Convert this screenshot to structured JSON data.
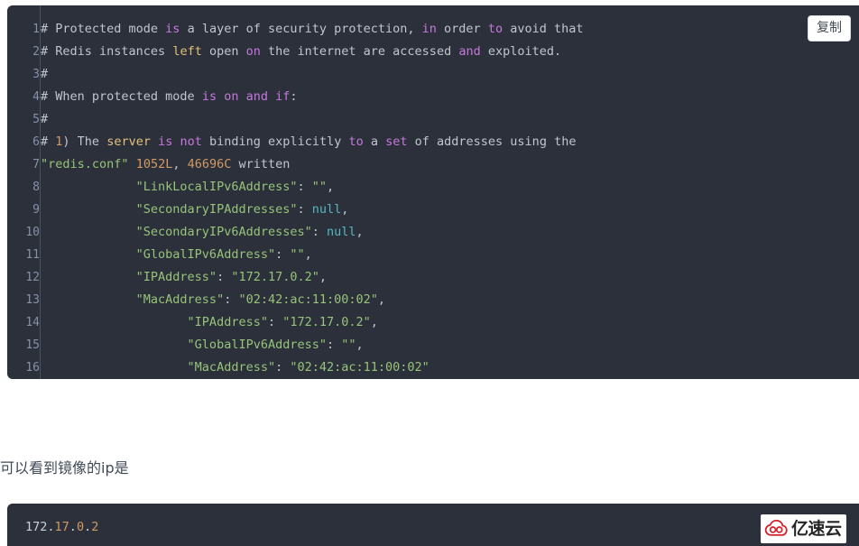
{
  "code_block_1": {
    "copy_button_label": "复制",
    "language": "bash",
    "lines": [
      {
        "n": "1",
        "tokens": [
          {
            "t": "# Protected mode ",
            "c": "cmt"
          },
          {
            "t": "is",
            "c": "kw"
          },
          {
            "t": " a layer of security protection, ",
            "c": "cmt"
          },
          {
            "t": "in",
            "c": "kw"
          },
          {
            "t": " order ",
            "c": "cmt"
          },
          {
            "t": "to",
            "c": "kw"
          },
          {
            "t": " avoid that",
            "c": "cmt"
          }
        ]
      },
      {
        "n": "2",
        "tokens": [
          {
            "t": "# Redis instances ",
            "c": "cmt"
          },
          {
            "t": "left",
            "c": "fn"
          },
          {
            "t": " open ",
            "c": "cmt"
          },
          {
            "t": "on",
            "c": "kw"
          },
          {
            "t": " the internet are accessed ",
            "c": "cmt"
          },
          {
            "t": "and",
            "c": "kw"
          },
          {
            "t": " exploited.",
            "c": "cmt"
          }
        ]
      },
      {
        "n": "3",
        "tokens": [
          {
            "t": "#",
            "c": "cmt"
          }
        ]
      },
      {
        "n": "4",
        "tokens": [
          {
            "t": "# When protected mode ",
            "c": "cmt"
          },
          {
            "t": "is",
            "c": "kw"
          },
          {
            "t": " ",
            "c": "cmt"
          },
          {
            "t": "on",
            "c": "kw"
          },
          {
            "t": " ",
            "c": "cmt"
          },
          {
            "t": "and",
            "c": "kw"
          },
          {
            "t": " ",
            "c": "cmt"
          },
          {
            "t": "if",
            "c": "kw"
          },
          {
            "t": ":",
            "c": "cmt"
          }
        ]
      },
      {
        "n": "5",
        "tokens": [
          {
            "t": "#",
            "c": "cmt"
          }
        ]
      },
      {
        "n": "6",
        "tokens": [
          {
            "t": "# ",
            "c": "cmt"
          },
          {
            "t": "1",
            "c": "num"
          },
          {
            "t": ") The ",
            "c": "cmt"
          },
          {
            "t": "server",
            "c": "fn"
          },
          {
            "t": " ",
            "c": "cmt"
          },
          {
            "t": "is",
            "c": "kw"
          },
          {
            "t": " ",
            "c": "cmt"
          },
          {
            "t": "not",
            "c": "kw"
          },
          {
            "t": " binding explicitly ",
            "c": "cmt"
          },
          {
            "t": "to",
            "c": "kw"
          },
          {
            "t": " a ",
            "c": "cmt"
          },
          {
            "t": "set",
            "c": "kw"
          },
          {
            "t": " of addresses using the",
            "c": "cmt"
          }
        ]
      },
      {
        "n": "7",
        "tokens": [
          {
            "t": "\"redis.conf\"",
            "c": "str"
          },
          {
            "t": " ",
            "c": "txt"
          },
          {
            "t": "1052L",
            "c": "num"
          },
          {
            "t": ", ",
            "c": "txt"
          },
          {
            "t": "46696C",
            "c": "num"
          },
          {
            "t": " written",
            "c": "txt"
          }
        ]
      },
      {
        "n": "8",
        "tokens": [
          {
            "t": "             \"LinkLocalIPv6Address\"",
            "c": "str"
          },
          {
            "t": ": ",
            "c": "txt"
          },
          {
            "t": "\"\"",
            "c": "str"
          },
          {
            "t": ",",
            "c": "txt"
          }
        ]
      },
      {
        "n": "9",
        "tokens": [
          {
            "t": "             \"SecondaryIPAddresses\"",
            "c": "str"
          },
          {
            "t": ": ",
            "c": "txt"
          },
          {
            "t": "null",
            "c": "null"
          },
          {
            "t": ",",
            "c": "txt"
          }
        ]
      },
      {
        "n": "10",
        "tokens": [
          {
            "t": "             \"SecondaryIPv6Addresses\"",
            "c": "str"
          },
          {
            "t": ": ",
            "c": "txt"
          },
          {
            "t": "null",
            "c": "null"
          },
          {
            "t": ",",
            "c": "txt"
          }
        ]
      },
      {
        "n": "11",
        "tokens": [
          {
            "t": "             \"GlobalIPv6Address\"",
            "c": "str"
          },
          {
            "t": ": ",
            "c": "txt"
          },
          {
            "t": "\"\"",
            "c": "str"
          },
          {
            "t": ",",
            "c": "txt"
          }
        ]
      },
      {
        "n": "12",
        "tokens": [
          {
            "t": "             \"IPAddress\"",
            "c": "str"
          },
          {
            "t": ": ",
            "c": "txt"
          },
          {
            "t": "\"172.17.0.2\"",
            "c": "str"
          },
          {
            "t": ",",
            "c": "txt"
          }
        ]
      },
      {
        "n": "13",
        "tokens": [
          {
            "t": "             \"MacAddress\"",
            "c": "str"
          },
          {
            "t": ": ",
            "c": "txt"
          },
          {
            "t": "\"02:42:ac:11:00:02\"",
            "c": "str"
          },
          {
            "t": ",",
            "c": "txt"
          }
        ]
      },
      {
        "n": "14",
        "tokens": [
          {
            "t": "                    \"IPAddress\"",
            "c": "str"
          },
          {
            "t": ": ",
            "c": "txt"
          },
          {
            "t": "\"172.17.0.2\"",
            "c": "str"
          },
          {
            "t": ",",
            "c": "txt"
          }
        ]
      },
      {
        "n": "15",
        "tokens": [
          {
            "t": "                    \"GlobalIPv6Address\"",
            "c": "str"
          },
          {
            "t": ": ",
            "c": "txt"
          },
          {
            "t": "\"\"",
            "c": "str"
          },
          {
            "t": ",",
            "c": "txt"
          }
        ]
      },
      {
        "n": "16",
        "tokens": [
          {
            "t": "                    \"MacAddress\"",
            "c": "str"
          },
          {
            "t": ": ",
            "c": "txt"
          },
          {
            "t": "\"02:42:ac:11:00:02\"",
            "c": "str"
          }
        ]
      }
    ]
  },
  "paragraph": {
    "text": "可以看到镜像的ip是"
  },
  "code_block_2": {
    "tokens": [
      {
        "t": "172",
        "c": "plain"
      },
      {
        "t": ".",
        "c": "plain"
      },
      {
        "t": "17",
        "c": "num"
      },
      {
        "t": ".",
        "c": "plain"
      },
      {
        "t": "0",
        "c": "num"
      },
      {
        "t": ".",
        "c": "plain"
      },
      {
        "t": "2",
        "c": "num"
      }
    ],
    "text": "172.17.0.2"
  },
  "watermark": {
    "brand": "亿速云",
    "logo_color": "#d5232e"
  },
  "theme": {
    "code_bg": "#2b303b",
    "page_bg": "#ffffff",
    "gutter_text": "#8691a6",
    "gutter_border": "#4a515f",
    "comment": "#c0c5ce",
    "keyword": "#c678dd",
    "function": "#e5c07b",
    "number": "#d19a66",
    "string": "#98c379",
    "constant": "#56b6c2"
  }
}
